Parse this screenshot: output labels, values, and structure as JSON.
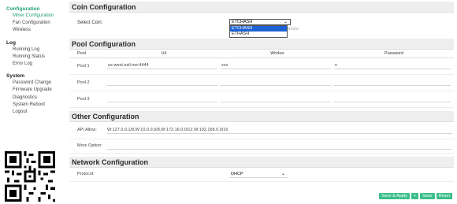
{
  "sidebar": {
    "groups": [
      {
        "label": "Configuration",
        "items": [
          "Miner Configuration",
          "Fan Configuration",
          "Wireless"
        ]
      },
      {
        "label": "Log",
        "items": [
          "Running Log",
          "Running Status",
          "Error Log"
        ]
      },
      {
        "label": "System",
        "items": [
          "Password Change",
          "Firmware Upgrade",
          "Diagnostics",
          "System Reboot",
          "Logout"
        ]
      }
    ]
  },
  "coin": {
    "title": "Coin Configuration",
    "select_label": "Select Coin:",
    "selected": "ETCHASH",
    "options": [
      "ETCHASH",
      "ETHASH"
    ],
    "hint_text": "ec/o/o"
  },
  "pool": {
    "title": "Pool Configuration",
    "headers": [
      "Pool",
      "Url",
      "Worker",
      "Password"
    ],
    "rows": [
      {
        "label": "Pool 1",
        "url": "us-west.ezil.me:4444",
        "worker": "xxx",
        "password": "x"
      },
      {
        "label": "Pool 2",
        "url": "",
        "worker": "",
        "password": ""
      },
      {
        "label": "Pool 3",
        "url": "",
        "worker": "",
        "password": ""
      }
    ]
  },
  "other": {
    "title": "Other Configuration",
    "api_label": "API Allow:",
    "api_value": "W:127.0.0.1/8,W:10.0.0.0/8,W:172.16.0.0/12,W:192.168.0.0/16",
    "more_label": "More Option:",
    "more_value": ""
  },
  "network": {
    "title": "Network Configuration",
    "protocol_label": "Protocol:",
    "protocol_value": "DHCP"
  },
  "buttons": {
    "save_apply": "Save & Apply",
    "plus": "+",
    "save": "Save",
    "reset": "Reset"
  },
  "colors": {
    "accent": "#3bbf88",
    "active_nav": "#25a071",
    "select_highlight": "#1e63d6"
  }
}
